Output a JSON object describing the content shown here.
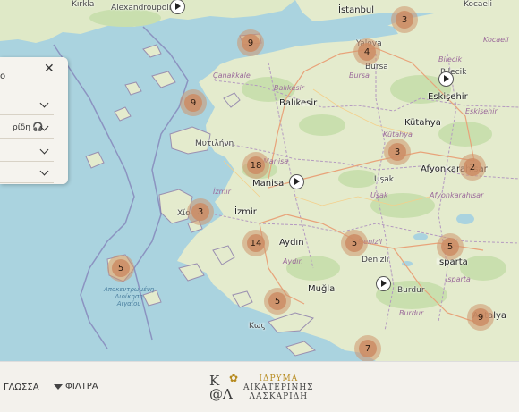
{
  "map": {
    "cities": [
      {
        "name": "İstanbul",
        "big": true
      },
      {
        "name": "Yalova",
        "big": false
      },
      {
        "name": "Bursa",
        "big": false
      },
      {
        "name": "Bilecik",
        "big": false
      },
      {
        "name": "Eskişehir",
        "big": true
      },
      {
        "name": "Balıkesir",
        "big": true
      },
      {
        "name": "Kütahya",
        "big": true
      },
      {
        "name": "Μυτιλήνη",
        "big": false
      },
      {
        "name": "Manisa",
        "big": true
      },
      {
        "name": "Uşak",
        "big": false
      },
      {
        "name": "Afyonkarahisar",
        "big": true
      },
      {
        "name": "İzmir",
        "big": true
      },
      {
        "name": "Aydın",
        "big": true
      },
      {
        "name": "Denizli",
        "big": false
      },
      {
        "name": "Isparta",
        "big": true
      },
      {
        "name": "Muğla",
        "big": true
      },
      {
        "name": "Burdur",
        "big": false
      },
      {
        "name": "Antalya",
        "big": true
      },
      {
        "name": "Κως",
        "big": false
      },
      {
        "name": "Χίο",
        "big": false
      },
      {
        "name": "Kocaeli",
        "big": false
      },
      {
        "name": "Alexandroupoli",
        "big": false
      },
      {
        "name": "Kırkla",
        "big": false
      }
    ],
    "provinces": [
      "Çanakkale",
      "Balıkesir",
      "Kütahya",
      "Eskişehir",
      "Manisa",
      "Afyonkarahisar",
      "İzmir",
      "Uşak",
      "Aydın",
      "Denizli",
      "Isparta",
      "Burdur",
      "Bursa",
      "Bilecik",
      "Kocaeli"
    ],
    "sea_label": [
      "Αποκεντρωμένη",
      "Διοίκηση",
      "Αιγαίου"
    ],
    "clusters": [
      {
        "id": "c1",
        "count": "3"
      },
      {
        "id": "c2",
        "count": "9"
      },
      {
        "id": "c3",
        "count": "4"
      },
      {
        "id": "c4",
        "count": "9"
      },
      {
        "id": "c5",
        "count": "3"
      },
      {
        "id": "c6",
        "count": "2"
      },
      {
        "id": "c7",
        "count": "18"
      },
      {
        "id": "c8",
        "count": "3"
      },
      {
        "id": "c9",
        "count": "14"
      },
      {
        "id": "c10",
        "count": "5"
      },
      {
        "id": "c11",
        "count": "5"
      },
      {
        "id": "c12",
        "count": "5"
      },
      {
        "id": "c13",
        "count": "5"
      },
      {
        "id": "c14",
        "count": "9"
      },
      {
        "id": "c15",
        "count": "7"
      }
    ]
  },
  "panel": {
    "head": "ο",
    "rows": [
      {
        "label": ""
      },
      {
        "label": "ρίδη",
        "headphones": "🎧"
      },
      {
        "label": ""
      },
      {
        "label": ""
      }
    ]
  },
  "footer": {
    "language": "ΓΛΩΣΣΑ",
    "filters": "ΦΙΛΤΡΑ",
    "logo": {
      "monogram_top": "Κ",
      "monogram_bottom": "@Λ",
      "line1": "ΙΔΡΥΜΑ",
      "line2": "ΑΙΚΑΤΕΡΙΝΗΣ",
      "line3": "ΛΑΣΚΑΡΙΔΗ"
    }
  }
}
